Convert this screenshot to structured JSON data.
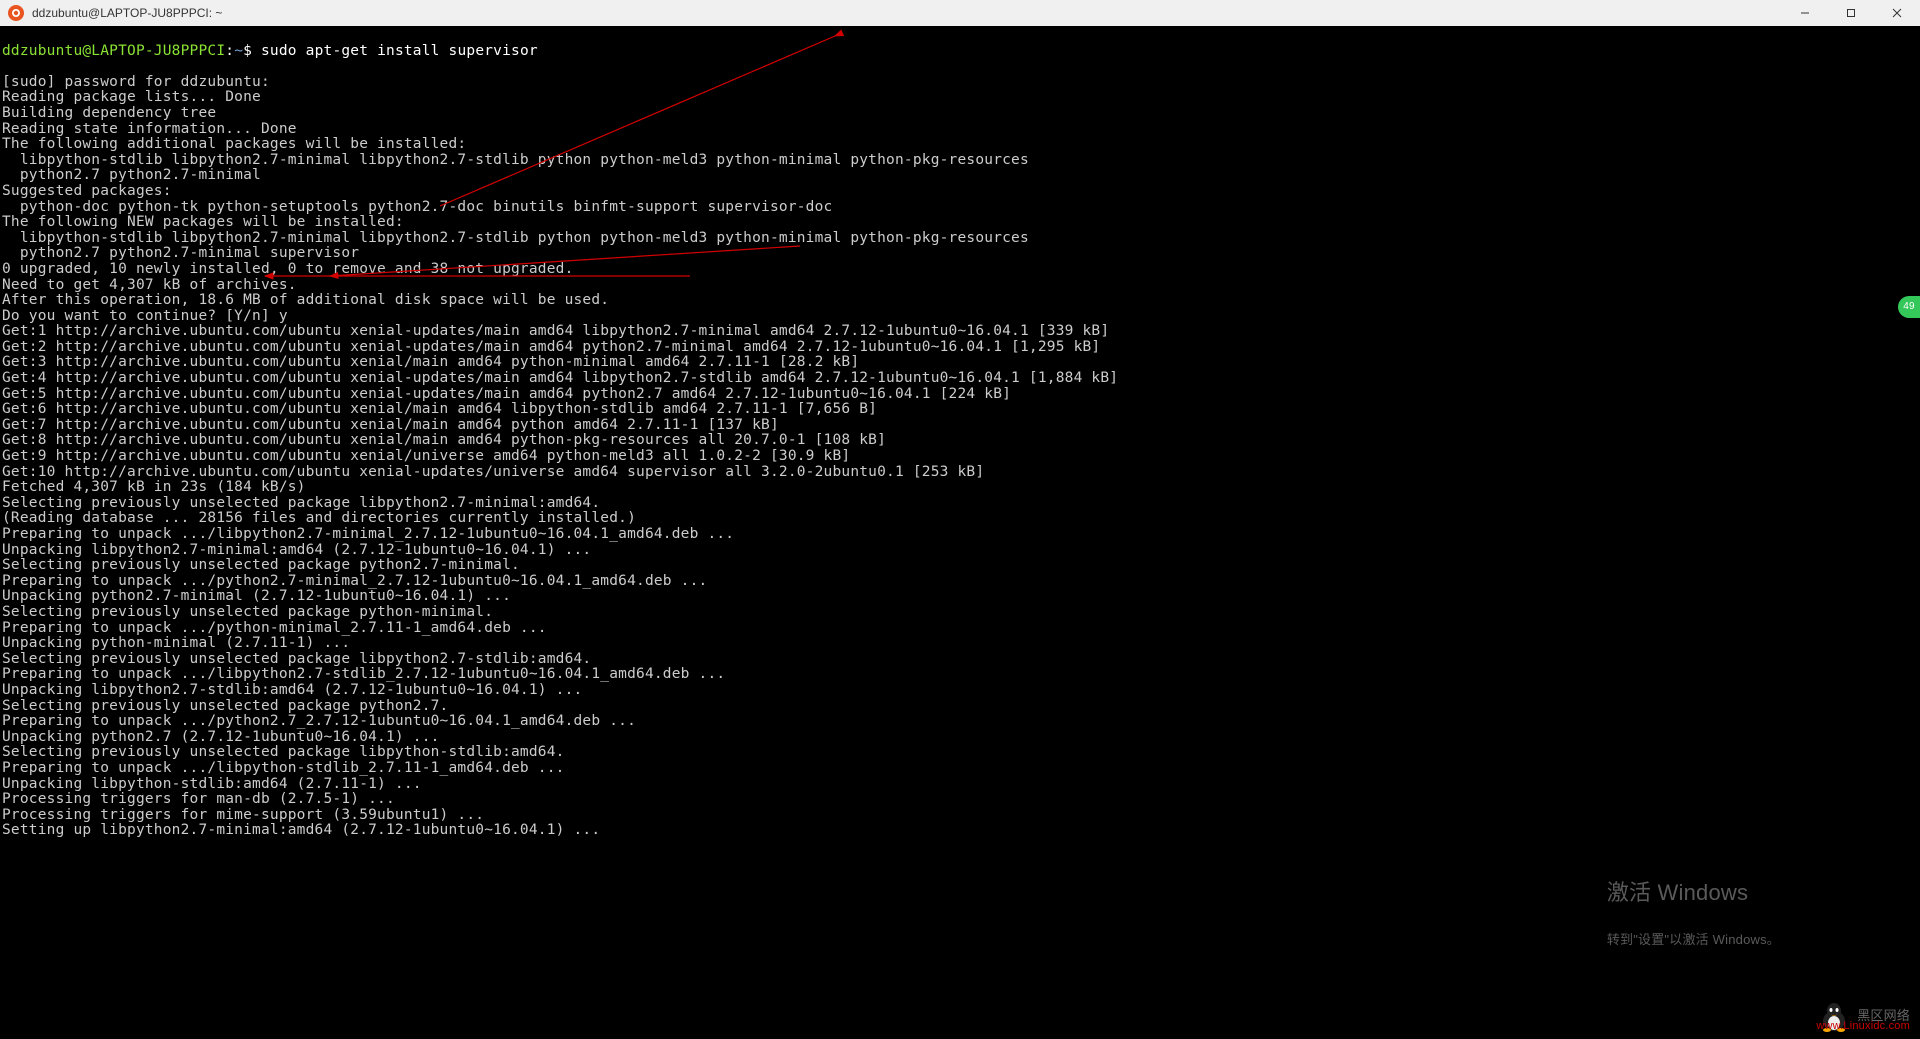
{
  "window": {
    "title": "ddzubuntu@LAPTOP-JU8PPPCI: ~"
  },
  "prompt": {
    "user_host": "ddzubuntu@LAPTOP-JU8PPPCI",
    "sep": ":",
    "path": "~",
    "dollar": "$ ",
    "command": "sudo apt-get install supervisor"
  },
  "lines": [
    "[sudo] password for ddzubuntu:",
    "Reading package lists... Done",
    "Building dependency tree",
    "Reading state information... Done",
    "The following additional packages will be installed:",
    "  libpython-stdlib libpython2.7-minimal libpython2.7-stdlib python python-meld3 python-minimal python-pkg-resources",
    "  python2.7 python2.7-minimal",
    "Suggested packages:",
    "  python-doc python-tk python-setuptools python2.7-doc binutils binfmt-support supervisor-doc",
    "The following NEW packages will be installed:",
    "  libpython-stdlib libpython2.7-minimal libpython2.7-stdlib python python-meld3 python-minimal python-pkg-resources",
    "  python2.7 python2.7-minimal supervisor",
    "0 upgraded, 10 newly installed, 0 to remove and 38 not upgraded.",
    "Need to get 4,307 kB of archives.",
    "After this operation, 18.6 MB of additional disk space will be used.",
    "Do you want to continue? [Y/n] y",
    "Get:1 http://archive.ubuntu.com/ubuntu xenial-updates/main amd64 libpython2.7-minimal amd64 2.7.12-1ubuntu0~16.04.1 [339 kB]",
    "Get:2 http://archive.ubuntu.com/ubuntu xenial-updates/main amd64 python2.7-minimal amd64 2.7.12-1ubuntu0~16.04.1 [1,295 kB]",
    "Get:3 http://archive.ubuntu.com/ubuntu xenial/main amd64 python-minimal amd64 2.7.11-1 [28.2 kB]",
    "Get:4 http://archive.ubuntu.com/ubuntu xenial-updates/main amd64 libpython2.7-stdlib amd64 2.7.12-1ubuntu0~16.04.1 [1,884 kB]",
    "Get:5 http://archive.ubuntu.com/ubuntu xenial-updates/main amd64 python2.7 amd64 2.7.12-1ubuntu0~16.04.1 [224 kB]",
    "Get:6 http://archive.ubuntu.com/ubuntu xenial/main amd64 libpython-stdlib amd64 2.7.11-1 [7,656 B]",
    "Get:7 http://archive.ubuntu.com/ubuntu xenial/main amd64 python amd64 2.7.11-1 [137 kB]",
    "Get:8 http://archive.ubuntu.com/ubuntu xenial/main amd64 python-pkg-resources all 20.7.0-1 [108 kB]",
    "Get:9 http://archive.ubuntu.com/ubuntu xenial/universe amd64 python-meld3 all 1.0.2-2 [30.9 kB]",
    "Get:10 http://archive.ubuntu.com/ubuntu xenial-updates/universe amd64 supervisor all 3.2.0-2ubuntu0.1 [253 kB]",
    "Fetched 4,307 kB in 23s (184 kB/s)",
    "Selecting previously unselected package libpython2.7-minimal:amd64.",
    "(Reading database ... 28156 files and directories currently installed.)",
    "Preparing to unpack .../libpython2.7-minimal_2.7.12-1ubuntu0~16.04.1_amd64.deb ...",
    "Unpacking libpython2.7-minimal:amd64 (2.7.12-1ubuntu0~16.04.1) ...",
    "Selecting previously unselected package python2.7-minimal.",
    "Preparing to unpack .../python2.7-minimal_2.7.12-1ubuntu0~16.04.1_amd64.deb ...",
    "Unpacking python2.7-minimal (2.7.12-1ubuntu0~16.04.1) ...",
    "Selecting previously unselected package python-minimal.",
    "Preparing to unpack .../python-minimal_2.7.11-1_amd64.deb ...",
    "Unpacking python-minimal (2.7.11-1) ...",
    "Selecting previously unselected package libpython2.7-stdlib:amd64.",
    "Preparing to unpack .../libpython2.7-stdlib_2.7.12-1ubuntu0~16.04.1_amd64.deb ...",
    "Unpacking libpython2.7-stdlib:amd64 (2.7.12-1ubuntu0~16.04.1) ...",
    "Selecting previously unselected package python2.7.",
    "Preparing to unpack .../python2.7_2.7.12-1ubuntu0~16.04.1_amd64.deb ...",
    "Unpacking python2.7 (2.7.12-1ubuntu0~16.04.1) ...",
    "Selecting previously unselected package libpython-stdlib:amd64.",
    "Preparing to unpack .../libpython-stdlib_2.7.11-1_amd64.deb ...",
    "Unpacking libpython-stdlib:amd64 (2.7.11-1) ...",
    "Processing triggers for man-db (2.7.5-1) ...",
    "Processing triggers for mime-support (3.59ubuntu1) ...",
    "Setting up libpython2.7-minimal:amd64 (2.7.12-1ubuntu0~16.04.1) ..."
  ],
  "badge": {
    "count": "49"
  },
  "watermark": {
    "line1": "激活 Windows",
    "line2": "转到\"设置\"以激活 Windows。",
    "logo_text": "黑区网络",
    "logo_url": "www.Linuxidc.com"
  }
}
